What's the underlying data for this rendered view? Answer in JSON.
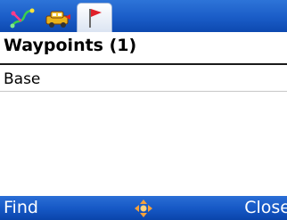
{
  "tabs": [
    {
      "icon": "route-icon",
      "selected": false
    },
    {
      "icon": "vehicles-icon",
      "selected": false
    },
    {
      "icon": "flag-icon",
      "selected": true
    }
  ],
  "header": {
    "title": "Waypoints (1)"
  },
  "waypoints": [
    {
      "label": "Base"
    }
  ],
  "softkeys": {
    "left_label": "Find",
    "center_icon": "dpad-icon",
    "right_label": "Close"
  },
  "colors": {
    "bar_blue": "#1a5cc7",
    "flag_red": "#e0202a",
    "text": "#000000",
    "softkey_text": "#ffffff"
  }
}
